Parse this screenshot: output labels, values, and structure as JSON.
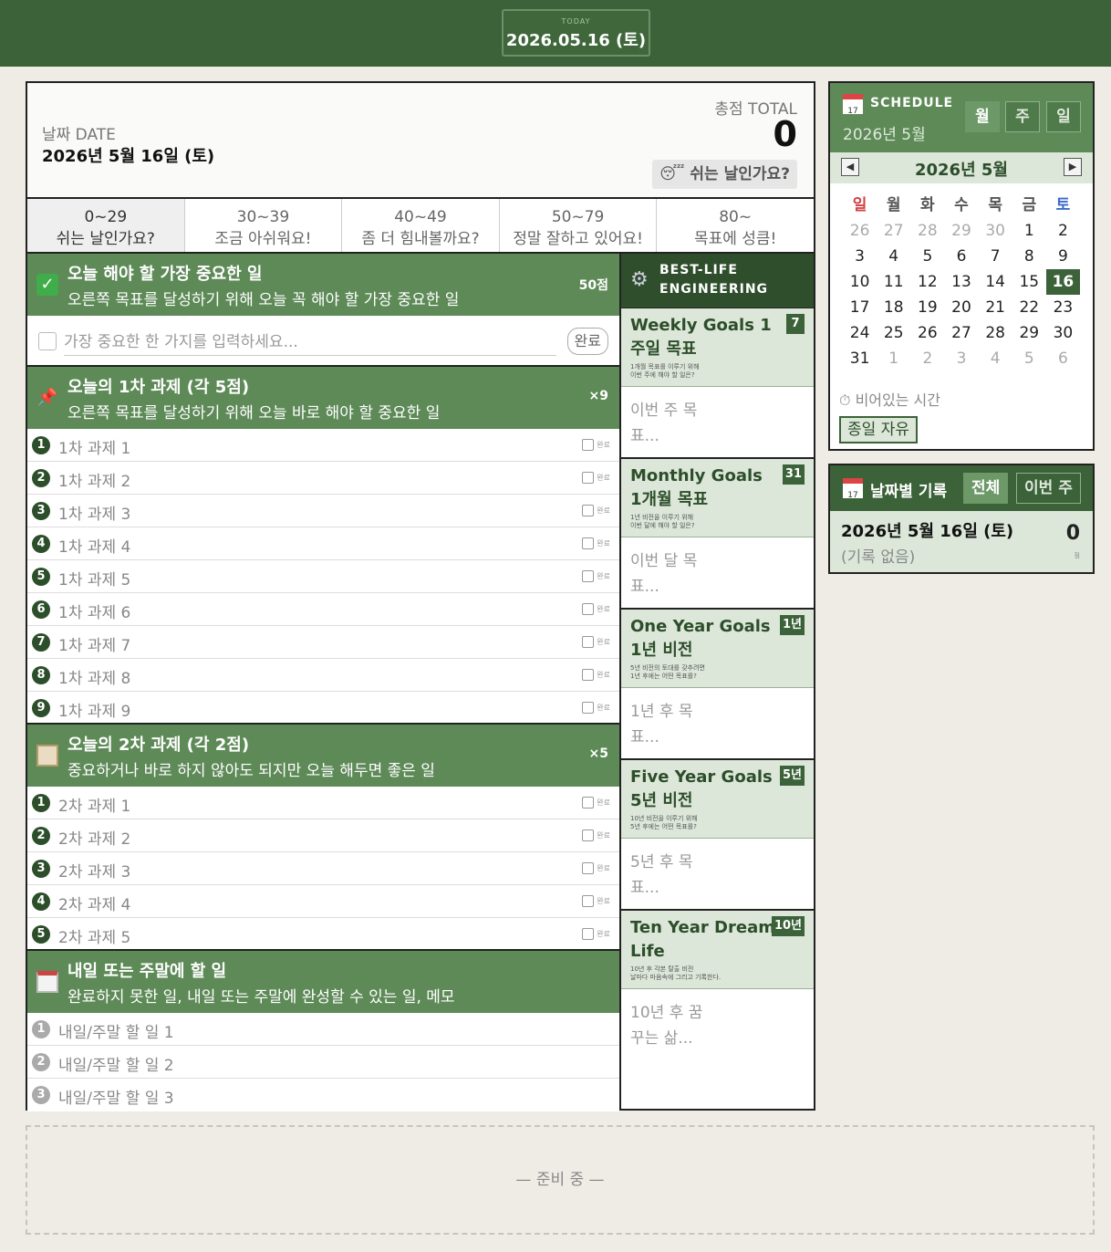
{
  "header": {
    "today_label": "TODAY",
    "today_date": "2026.05.16 (토)"
  },
  "daily": {
    "date_label": "날짜 DATE",
    "date_value": "2026년 5월 16일 (토)",
    "total_label": "총점 TOTAL",
    "total_value": "0",
    "rest_text": "😴 쉬는 날인가요?"
  },
  "levels": [
    {
      "range": "0~29",
      "text": "쉬는 날인가요?"
    },
    {
      "range": "30~39",
      "text": "조금 아쉬워요!"
    },
    {
      "range": "40~49",
      "text": "좀 더 힘내볼까요?"
    },
    {
      "range": "50~79",
      "text": "정말 잘하고 있어요!"
    },
    {
      "range": "80~",
      "text": "목표에 성큼!"
    }
  ],
  "important": {
    "title": "오늘 해야 할 가장 중요한 일",
    "desc": "오른쪽 목표를 달성하기 위해 오늘 꼭 해야 할 가장 중요한 일",
    "score": "50점",
    "placeholder": "가장 중요한 한 가지를 입력하세요...",
    "done_label": "완료"
  },
  "primary": {
    "title": "오늘의 1차 과제 (각 5점)",
    "desc": "오른쪽 목표를 달성하기 위해 오늘 바로 해야 할 중요한 일",
    "score": "×9",
    "done_label": "완료",
    "tasks": [
      "1차 과제 1",
      "1차 과제 2",
      "1차 과제 3",
      "1차 과제 4",
      "1차 과제 5",
      "1차 과제 6",
      "1차 과제 7",
      "1차 과제 8",
      "1차 과제 9"
    ]
  },
  "secondary": {
    "title": "오늘의 2차 과제 (각 2점)",
    "desc": "중요하거나 바로 하지 않아도 되지만 오늘 해두면 좋은 일",
    "score": "×5",
    "done_label": "완료",
    "tasks": [
      "2차 과제 1",
      "2차 과제 2",
      "2차 과제 3",
      "2차 과제 4",
      "2차 과제 5"
    ]
  },
  "tomorrow": {
    "title": "내일 또는 주말에 할 일",
    "desc": "완료하지 못한 일, 내일 또는 주말에 완성할 수 있는 일, 메모",
    "tasks": [
      "내일/주말 할 일 1",
      "내일/주말 할 일 2",
      "내일/주말 할 일 3"
    ]
  },
  "numbers": [
    "1",
    "2",
    "3",
    "4",
    "5",
    "6",
    "7",
    "8",
    "9"
  ],
  "bestlife": {
    "line1": "BEST-LIFE",
    "line2": "ENGINEERING"
  },
  "goals": [
    {
      "title": "Weekly Goals 1주일 목표",
      "badge": "7",
      "sub1": "1개월 목표를 이루기 위해",
      "sub2": "이번 주에 해야 할 일은?",
      "placeholder": "이번 주 목표..."
    },
    {
      "title": "Monthly Goals 1개월 목표",
      "badge": "31",
      "sub1": "1년 비전을 이루기 위해",
      "sub2": "이번 달에 해야 할 일은?",
      "placeholder": "이번 달 목표..."
    },
    {
      "title": "One Year Goals 1년 비전",
      "badge": "1년",
      "sub1": "5년 비전의 토대를 갖추려면",
      "sub2": "1년 후에는 어떤 목표를?",
      "placeholder": "1년 후 목표..."
    },
    {
      "title": "Five Year Goals 5년 비전",
      "badge": "5년",
      "sub1": "10년 비전을 이루기 위해",
      "sub2": "5년 후에는 어떤 목표를?",
      "placeholder": "5년 후 목표..."
    },
    {
      "title": "Ten Year Dream Life",
      "badge": "10년",
      "sub1": "10년 후 각본 탈출 비전",
      "sub2": "날마다 마음속에 그리고 기록한다.",
      "placeholder": "10년 후 꿈꾸는 삶..."
    }
  ],
  "schedule": {
    "title": "SCHEDULE",
    "subtitle": "2026년 5월",
    "icon_day": "17",
    "views": [
      "월",
      "주",
      "일"
    ],
    "month_title": "2026년 5월",
    "prev": "◀",
    "next": "▶",
    "dow": [
      "일",
      "월",
      "화",
      "수",
      "목",
      "금",
      "토"
    ],
    "weeks": [
      [
        "26",
        "27",
        "28",
        "29",
        "30",
        "1",
        "2"
      ],
      [
        "3",
        "4",
        "5",
        "6",
        "7",
        "8",
        "9"
      ],
      [
        "10",
        "11",
        "12",
        "13",
        "14",
        "15",
        "16"
      ],
      [
        "17",
        "18",
        "19",
        "20",
        "21",
        "22",
        "23"
      ],
      [
        "24",
        "25",
        "26",
        "27",
        "28",
        "29",
        "30"
      ],
      [
        "31",
        "1",
        "2",
        "3",
        "4",
        "5",
        "6"
      ]
    ],
    "free_label": "⏱ 비어있는 시간",
    "free_btn": "종일 자유"
  },
  "log": {
    "title": "날짜별 기록",
    "icon_day": "17",
    "btn_all": "전체",
    "btn_week": "이번 주",
    "date": "2026년 5월 16일 (토)",
    "none": "(기록 없음)",
    "score": "0",
    "unit": "점"
  },
  "footer": {
    "text": "— 준비 중 —"
  }
}
